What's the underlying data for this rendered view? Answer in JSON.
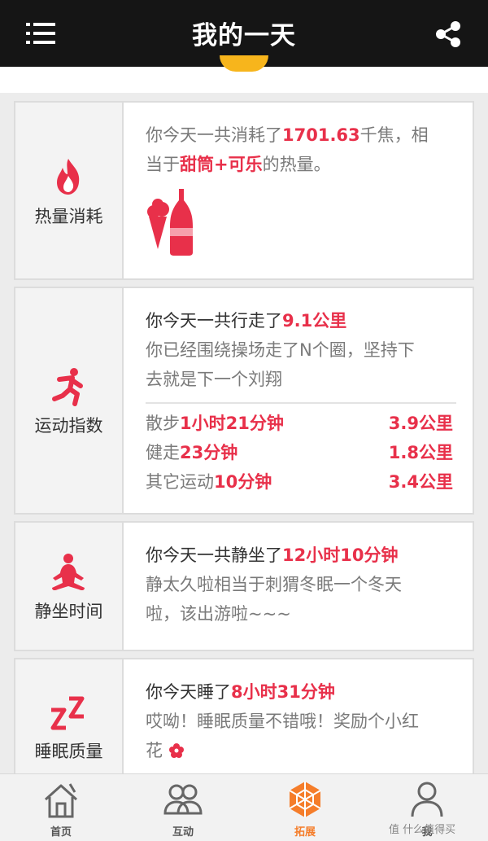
{
  "header": {
    "title": "我的一天",
    "menu_icon": "menu-icon",
    "share_icon": "share-icon"
  },
  "colors": {
    "accent": "#e8304a",
    "active_tab": "#f57d2a",
    "header_bg": "#151515"
  },
  "cards": {
    "calories": {
      "label": "热量消耗",
      "line1_a": "你今天一共消耗了",
      "line1_value": "1701.63",
      "line1_b": "千焦，相",
      "line2_a": "当于",
      "line2_food1": "甜筒",
      "line2_plus": "+",
      "line2_food2": "可乐",
      "line2_b": "的热量。"
    },
    "exercise": {
      "label": "运动指数",
      "line1_a": "你今天一共行走了",
      "line1_value": "9.1公里",
      "line2": "你已经围绕操场走了N个圈，坚持下",
      "line3": "去就是下一个刘翔",
      "rows": [
        {
          "name": "散步",
          "time": "1小时21分钟",
          "distance": "3.9公里"
        },
        {
          "name": "健走",
          "time": "23分钟",
          "distance": "1.8公里"
        },
        {
          "name": "其它运动",
          "time": "10分钟",
          "distance": "3.4公里"
        }
      ]
    },
    "sedentary": {
      "label": "静坐时间",
      "line1_a": "你今天一共静坐了",
      "line1_value": "12小时10分钟",
      "line2": "静太久啦相当于刺猬冬眠一个冬天",
      "line3": "啦，该出游啦~~~"
    },
    "sleep": {
      "label": "睡眠质量",
      "line1_a": "你今天睡了",
      "line1_value": "8小时31分钟",
      "line2": "哎呦！睡眠质量不错哦！奖励个小红",
      "line3": "花"
    }
  },
  "tabs": [
    {
      "label": "首页",
      "icon": "home-icon"
    },
    {
      "label": "互动",
      "icon": "people-icon"
    },
    {
      "label": "拓展",
      "icon": "expand-icon",
      "active": true
    },
    {
      "label": "我",
      "icon": "person-icon"
    }
  ],
  "watermark": "值 什么值得买"
}
